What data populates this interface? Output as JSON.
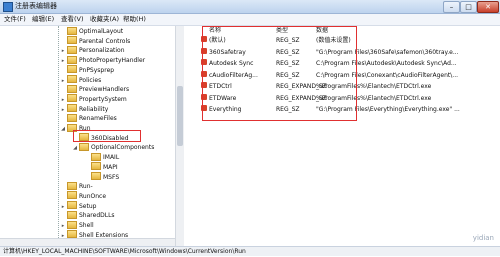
{
  "window": {
    "title": "注册表编辑器",
    "minimize": "–",
    "maximize": "□",
    "close": "✕"
  },
  "menu": [
    "文件(F)",
    "编辑(E)",
    "查看(V)",
    "收藏夹(A)",
    "帮助(H)"
  ],
  "tree": [
    {
      "label": "OptimalLayout",
      "indent": 0,
      "expander": ""
    },
    {
      "label": "Parental Controls",
      "indent": 0,
      "expander": ""
    },
    {
      "label": "Personalization",
      "indent": 0,
      "expander": "▸"
    },
    {
      "label": "PhotoPropertyHandler",
      "indent": 0,
      "expander": "▸"
    },
    {
      "label": "PnPSysprep",
      "indent": 0,
      "expander": ""
    },
    {
      "label": "Policies",
      "indent": 0,
      "expander": "▸"
    },
    {
      "label": "PreviewHandlers",
      "indent": 0,
      "expander": ""
    },
    {
      "label": "PropertySystem",
      "indent": 0,
      "expander": "▸"
    },
    {
      "label": "Reliability",
      "indent": 0,
      "expander": "▸"
    },
    {
      "label": "RenameFiles",
      "indent": 0,
      "expander": ""
    },
    {
      "label": "Run",
      "indent": 0,
      "expander": "◢"
    },
    {
      "label": "360Disabled",
      "indent": 1,
      "expander": ""
    },
    {
      "label": "OptionalComponents",
      "indent": 1,
      "expander": "◢"
    },
    {
      "label": "IMAIL",
      "indent": 2,
      "expander": ""
    },
    {
      "label": "MAPI",
      "indent": 2,
      "expander": ""
    },
    {
      "label": "MSFS",
      "indent": 2,
      "expander": ""
    },
    {
      "label": "Run-",
      "indent": 0,
      "expander": ""
    },
    {
      "label": "RunOnce",
      "indent": 0,
      "expander": ""
    },
    {
      "label": "Setup",
      "indent": 0,
      "expander": "▸"
    },
    {
      "label": "SharedDLLs",
      "indent": 0,
      "expander": ""
    },
    {
      "label": "Shell",
      "indent": 0,
      "expander": "▸"
    },
    {
      "label": "Shell Extensions",
      "indent": 0,
      "expander": "▸"
    }
  ],
  "columns": {
    "name": "名称",
    "type": "类型",
    "data": "数据"
  },
  "values": [
    {
      "name": "(默认)",
      "type": "REG_SZ",
      "data": "(数值未设置)"
    },
    {
      "name": "360Safetray",
      "type": "REG_SZ",
      "data": "\"G:\\Program Files\\360Safe\\safemon\\360tray.e..."
    },
    {
      "name": "Autodesk Sync",
      "type": "REG_SZ",
      "data": "C:\\Program Files\\Autodesk\\Autodesk Sync\\Ad..."
    },
    {
      "name": "cAudioFilterAg...",
      "type": "REG_SZ",
      "data": "C:\\Program Files\\Conexant\\cAudioFilterAgent\\..."
    },
    {
      "name": "ETDCtrl",
      "type": "REG_EXPAND_SZ",
      "data": "%ProgramFiles%\\Elantech\\ETDCtrl.exe"
    },
    {
      "name": "ETDWare",
      "type": "REG_EXPAND_SZ",
      "data": "%ProgramFiles%\\Elantech\\ETDCtrl.exe"
    },
    {
      "name": "Everything",
      "type": "REG_SZ",
      "data": "\"G:\\Program Files\\Everything\\Everything.exe\" ..."
    }
  ],
  "status": "计算机\\HKEY_LOCAL_MACHINE\\SOFTWARE\\Microsoft\\Windows\\CurrentVersion\\Run",
  "watermark": "yidian",
  "colors": {
    "highlight_box": "#e03030",
    "value_icon": "#d8412a",
    "folder": "#e5b640"
  }
}
